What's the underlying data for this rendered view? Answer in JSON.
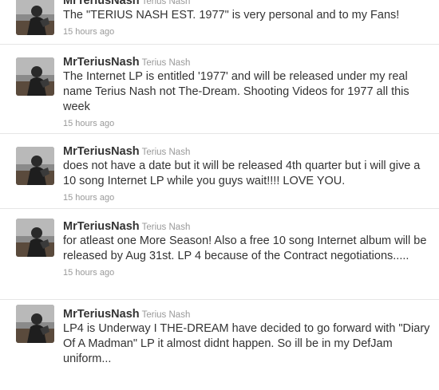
{
  "tweets": [
    {
      "screen_name": "MrTeriusNash",
      "full_name": "Terius Nash",
      "text": "The \"TERIUS NASH EST. 1977\" is very personal and to my Fans!",
      "time": "15 hours ago"
    },
    {
      "screen_name": "MrTeriusNash",
      "full_name": "Terius Nash",
      "text": "The Internet LP is entitled '1977' and will be released under my real name Terius Nash not The-Dream. Shooting Videos for 1977 all this week",
      "time": "15 hours ago"
    },
    {
      "screen_name": "MrTeriusNash",
      "full_name": "Terius Nash",
      "text": "does not have a date but it will be released 4th quarter but i will give a 10 song Internet LP while you guys wait!!!! LOVE YOU.",
      "time": "15 hours ago"
    },
    {
      "screen_name": "MrTeriusNash",
      "full_name": "Terius Nash",
      "text": "for atleast one More Season! Also a free 10 song Internet album will be released by Aug 31st. LP 4 because of the Contract negotiations.....",
      "time": "15 hours ago"
    },
    {
      "screen_name": "MrTeriusNash",
      "full_name": "Terius Nash",
      "text": "LP4 is Underway I THE-DREAM have decided to go forward with \"Diary Of A Madman\" LP it almost didnt happen. So ill be in my DefJam uniform...",
      "time": ""
    }
  ],
  "colors": {
    "text": "#333333",
    "meta": "#999999",
    "divider": "#e6e6e6"
  },
  "icons": {
    "avatar": "profile-photo"
  }
}
